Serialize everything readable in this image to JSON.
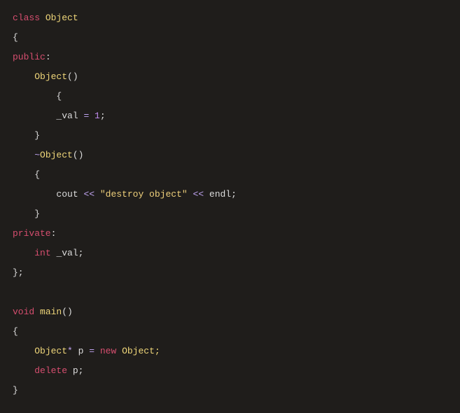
{
  "code": {
    "lines": [
      {
        "indent": 0,
        "tokens": [
          {
            "t": "class ",
            "c": "kw-type"
          },
          {
            "t": "Object",
            "c": "cls"
          }
        ]
      },
      {
        "indent": 0,
        "tokens": [
          {
            "t": "{",
            "c": "ident"
          }
        ]
      },
      {
        "indent": 0,
        "tokens": [
          {
            "t": "public",
            "c": "kw-type"
          },
          {
            "t": ":",
            "c": "ident"
          }
        ]
      },
      {
        "indent": 1,
        "tokens": [
          {
            "t": "Object",
            "c": "cls"
          },
          {
            "t": "()",
            "c": "ident"
          }
        ]
      },
      {
        "indent": 2,
        "tokens": [
          {
            "t": "{",
            "c": "ident"
          }
        ]
      },
      {
        "indent": 2,
        "tokens": [
          {
            "t": "_val ",
            "c": "member"
          },
          {
            "t": "= ",
            "c": "op"
          },
          {
            "t": "1",
            "c": "num"
          },
          {
            "t": ";",
            "c": "ident"
          }
        ]
      },
      {
        "indent": 1,
        "tokens": [
          {
            "t": "}",
            "c": "ident"
          }
        ]
      },
      {
        "indent": 1,
        "tokens": [
          {
            "t": "~",
            "c": "op"
          },
          {
            "t": "Object",
            "c": "cls"
          },
          {
            "t": "()",
            "c": "ident"
          }
        ]
      },
      {
        "indent": 1,
        "tokens": [
          {
            "t": "{",
            "c": "ident"
          }
        ]
      },
      {
        "indent": 2,
        "tokens": [
          {
            "t": "cout ",
            "c": "ident"
          },
          {
            "t": "<< ",
            "c": "op"
          },
          {
            "t": "\"destroy object\"",
            "c": "str"
          },
          {
            "t": " << ",
            "c": "op"
          },
          {
            "t": "endl;",
            "c": "ident"
          }
        ]
      },
      {
        "indent": 1,
        "tokens": [
          {
            "t": "}",
            "c": "ident"
          }
        ]
      },
      {
        "indent": 0,
        "tokens": [
          {
            "t": "private",
            "c": "kw-type"
          },
          {
            "t": ":",
            "c": "ident"
          }
        ]
      },
      {
        "indent": 1,
        "tokens": [
          {
            "t": "int ",
            "c": "kw-type"
          },
          {
            "t": "_val;",
            "c": "member"
          }
        ]
      },
      {
        "indent": 0,
        "tokens": [
          {
            "t": "};",
            "c": "ident"
          }
        ]
      },
      {
        "indent": 0,
        "tokens": []
      },
      {
        "indent": 0,
        "tokens": [
          {
            "t": "void ",
            "c": "kw-type"
          },
          {
            "t": "main",
            "c": "cls"
          },
          {
            "t": "()",
            "c": "ident"
          }
        ]
      },
      {
        "indent": 0,
        "tokens": [
          {
            "t": "{",
            "c": "ident"
          }
        ]
      },
      {
        "indent": 1,
        "tokens": [
          {
            "t": "Object",
            "c": "cls"
          },
          {
            "t": "* ",
            "c": "op"
          },
          {
            "t": "p ",
            "c": "ident"
          },
          {
            "t": "= ",
            "c": "op"
          },
          {
            "t": "new ",
            "c": "kw-type"
          },
          {
            "t": "Object;",
            "c": "cls"
          }
        ]
      },
      {
        "indent": 1,
        "tokens": [
          {
            "t": "delete ",
            "c": "kw-type"
          },
          {
            "t": "p;",
            "c": "ident"
          }
        ]
      },
      {
        "indent": 0,
        "tokens": [
          {
            "t": "}",
            "c": "ident"
          }
        ]
      }
    ],
    "indent_unit": "    "
  }
}
